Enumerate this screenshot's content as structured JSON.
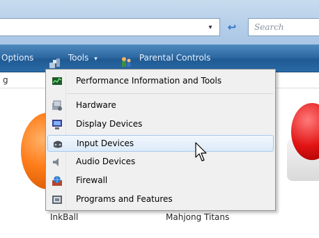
{
  "address_bar": {
    "search_placeholder": "Search",
    "refresh_glyph": "↩",
    "dropdown_glyph": "▾"
  },
  "toolbar": {
    "options_label": "Options",
    "tools_label": "Tools",
    "parental_label": "Parental Controls",
    "caret_glyph": "▾"
  },
  "column_header": {
    "label": "g"
  },
  "menu": {
    "items": [
      {
        "label": "Performance Information and Tools",
        "icon": "performance-icon"
      },
      {
        "label": "Hardware",
        "icon": "hardware-icon"
      },
      {
        "label": "Display Devices",
        "icon": "display-icon"
      },
      {
        "label": "Input Devices",
        "icon": "input-devices-icon"
      },
      {
        "label": "Audio Devices",
        "icon": "audio-icon"
      },
      {
        "label": "Firewall",
        "icon": "firewall-icon"
      },
      {
        "label": "Programs and Features",
        "icon": "programs-icon"
      }
    ],
    "hovered_index": 3
  },
  "games": {
    "inkball": "InkBall",
    "mahjong": "Mahjong Titans"
  },
  "colors": {
    "toolbar": "#2f6aa3",
    "menu_bg": "#f0f0f0",
    "hover_bg": "#dceaf9",
    "hover_border": "#a8c8eb"
  }
}
